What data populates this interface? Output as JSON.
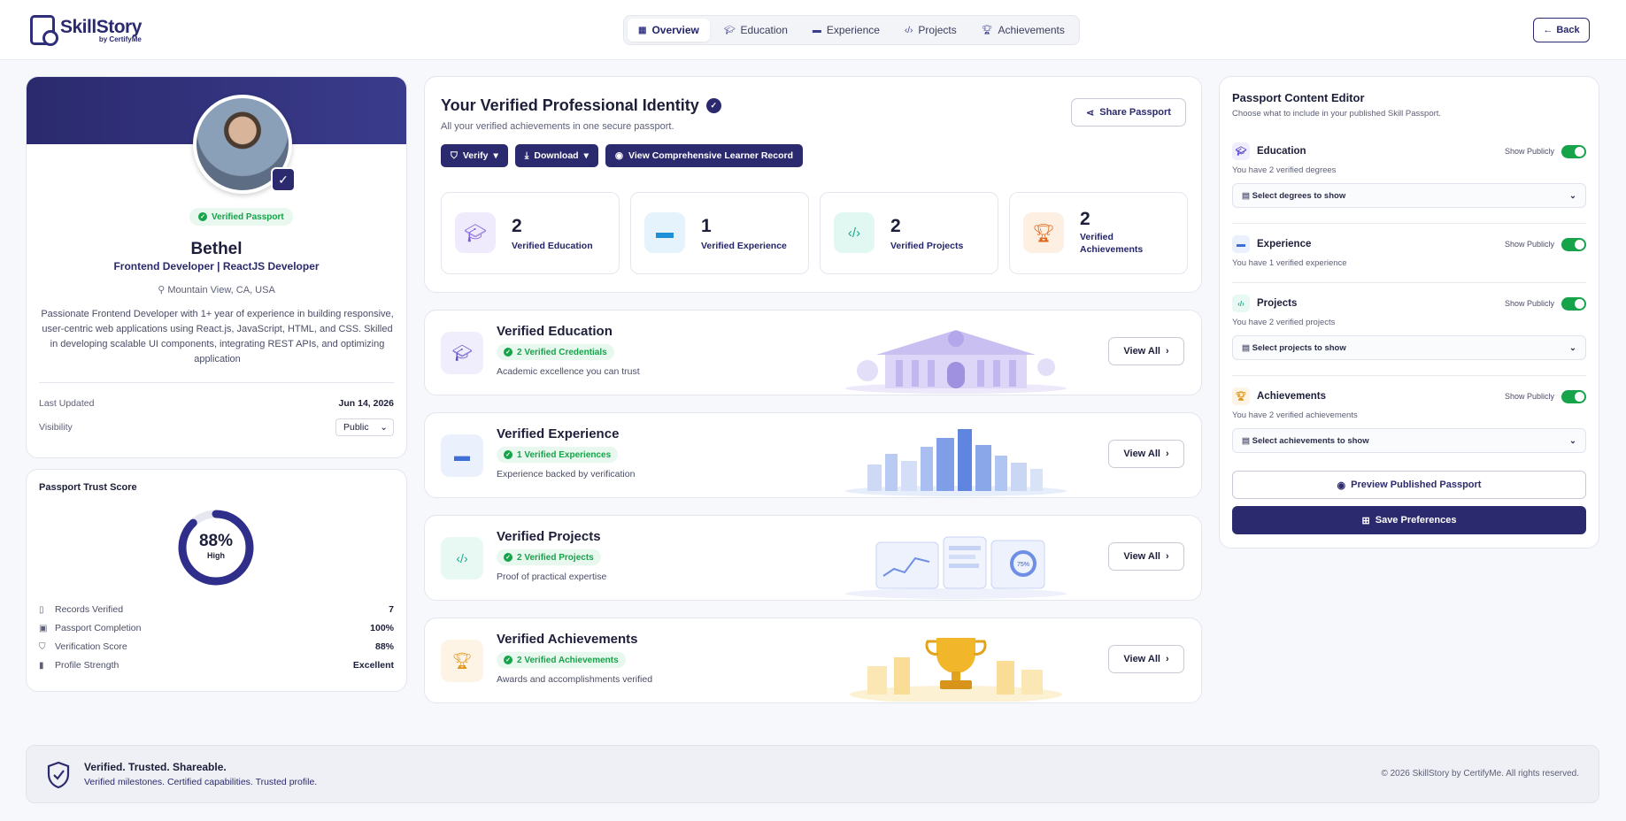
{
  "brand": {
    "name": "SkillStory",
    "sub": "by CertifyMe"
  },
  "nav": {
    "tabs": [
      {
        "label": "Overview",
        "icon": "grid-icon",
        "active": true
      },
      {
        "label": "Education",
        "icon": "graduation-cap-icon"
      },
      {
        "label": "Experience",
        "icon": "briefcase-icon"
      },
      {
        "label": "Projects",
        "icon": "code-icon"
      },
      {
        "label": "Achievements",
        "icon": "trophy-icon"
      }
    ],
    "back_label": "Back"
  },
  "profile": {
    "verified_label": "Verified Passport",
    "name": "Bethel",
    "role": "Frontend Developer | ReactJS Developer",
    "location": "Mountain View, CA, USA",
    "bio": "Passionate Frontend Developer with 1+ year of experience in building responsive, user-centric web applications using React.js, JavaScript, HTML, and CSS. Skilled in developing scalable UI components, integrating REST APIs, and optimizing application",
    "last_updated_label": "Last Updated",
    "last_updated_value": "Jun 14, 2026",
    "visibility_label": "Visibility",
    "visibility_value": "Public"
  },
  "trust": {
    "title": "Passport Trust Score",
    "score": "88%",
    "score_fraction": 0.88,
    "level": "High",
    "rows": [
      {
        "label": "Records Verified",
        "value": "7",
        "icon": "document-icon"
      },
      {
        "label": "Passport Completion",
        "value": "100%",
        "icon": "clipboard-icon"
      },
      {
        "label": "Verification Score",
        "value": "88%",
        "icon": "shield-icon"
      },
      {
        "label": "Profile Strength",
        "value": "Excellent",
        "icon": "bars-icon"
      }
    ]
  },
  "identity": {
    "title": "Your Verified Professional Identity",
    "subtitle": "All your verified achievements in one secure passport.",
    "share_label": "Share Passport",
    "verify_label": "Verify",
    "download_label": "Download",
    "record_label": "View Comprehensive Learner Record",
    "stats": [
      {
        "num": "2",
        "label": "Verified Education",
        "color": "#7c5cdb",
        "bg": "#f0ebfc",
        "icon": "graduation-cap-icon"
      },
      {
        "num": "1",
        "label": "Verified Experience",
        "color": "#1f8fd8",
        "bg": "#e5f3fc",
        "icon": "briefcase-icon"
      },
      {
        "num": "2",
        "label": "Verified Projects",
        "color": "#1aa88a",
        "bg": "#e1f8f2",
        "icon": "code-icon"
      },
      {
        "num": "2",
        "label": "Verified Achievements",
        "color": "#e0661b",
        "bg": "#fdf0e3",
        "icon": "trophy-icon"
      }
    ]
  },
  "sections": [
    {
      "title": "Verified Education",
      "pill": "2 Verified Credentials",
      "sub": "Academic excellence you can trust",
      "view": "View All",
      "icon": "graduation-cap-icon",
      "color": "#5b4cc9",
      "bg": "#f0eefc"
    },
    {
      "title": "Verified Experience",
      "pill": "1 Verified Experiences",
      "sub": "Experience backed by verification",
      "view": "View All",
      "icon": "briefcase-icon",
      "color": "#3f6fd6",
      "bg": "#eaf0fc"
    },
    {
      "title": "Verified Projects",
      "pill": "2 Verified Projects",
      "sub": "Proof of practical expertise",
      "view": "View All",
      "icon": "code-icon",
      "color": "#1aa88a",
      "bg": "#e8f8f3"
    },
    {
      "title": "Verified Achievements",
      "pill": "2 Verified Achievements",
      "sub": "Awards and accomplishments verified",
      "view": "View All",
      "icon": "trophy-icon",
      "color": "#e0951b",
      "bg": "#fdf4e6"
    }
  ],
  "art": {
    "projects_gauge": "75%"
  },
  "editor": {
    "title": "Passport Content Editor",
    "subtitle": "Choose what to include in your published Skill Passport.",
    "show_label": "Show Publicly",
    "blocks": [
      {
        "name": "Education",
        "desc": "You have 2 verified degrees",
        "select": "Select degrees to show",
        "icon": "graduation-cap-icon",
        "color": "#5b4cc9",
        "bg": "#f0eefc"
      },
      {
        "name": "Experience",
        "desc": "You have 1 verified experience",
        "icon": "briefcase-icon",
        "color": "#3f6fd6",
        "bg": "#eaf0fc"
      },
      {
        "name": "Projects",
        "desc": "You have 2 verified projects",
        "select": "Select projects to show",
        "icon": "code-icon",
        "color": "#1aa88a",
        "bg": "#e8f8f3"
      },
      {
        "name": "Achievements",
        "desc": "You have 2 verified achievements",
        "select": "Select achievements to show",
        "icon": "trophy-icon",
        "color": "#e0951b",
        "bg": "#fdf4e6"
      }
    ],
    "preview_label": "Preview Published Passport",
    "save_label": "Save Preferences"
  },
  "footer": {
    "title": "Verified. Trusted. Shareable.",
    "subtitle": "Verified milestones. Certified capabilities. Trusted profile.",
    "copyright": "© 2026 SkillStory by CertifyMe. All rights reserved."
  }
}
